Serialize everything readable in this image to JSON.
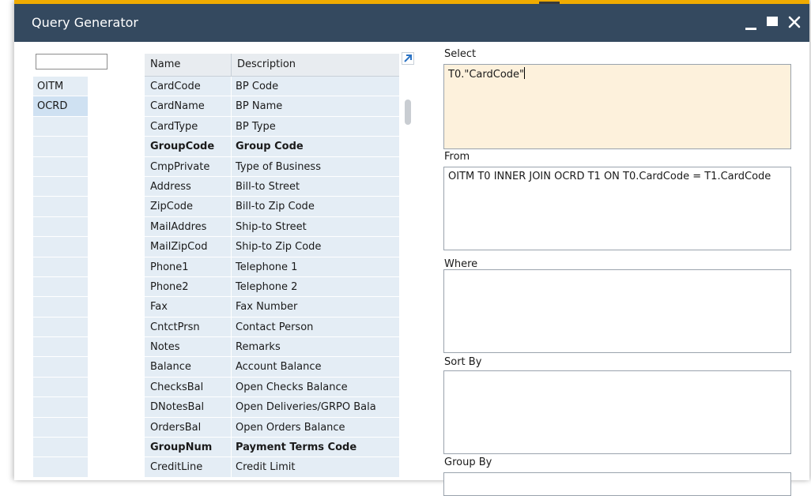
{
  "window": {
    "title": "Query Generator"
  },
  "tables": {
    "search_value": "",
    "items": [
      "OITM",
      "OCRD"
    ],
    "selected": "OCRD",
    "empty_rows": 18
  },
  "fields": {
    "columns": [
      "Name",
      "Description"
    ],
    "rows": [
      {
        "name": "CardCode",
        "desc": "BP Code",
        "bold": false
      },
      {
        "name": "CardName",
        "desc": "BP Name",
        "bold": false
      },
      {
        "name": "CardType",
        "desc": "BP Type",
        "bold": false
      },
      {
        "name": "GroupCode",
        "desc": "Group Code",
        "bold": true
      },
      {
        "name": "CmpPrivate",
        "desc": "Type of Business",
        "bold": false
      },
      {
        "name": "Address",
        "desc": "Bill-to Street",
        "bold": false
      },
      {
        "name": "ZipCode",
        "desc": "Bill-to Zip Code",
        "bold": false
      },
      {
        "name": "MailAddres",
        "desc": "Ship-to Street",
        "bold": false
      },
      {
        "name": "MailZipCod",
        "desc": "Ship-to Zip Code",
        "bold": false
      },
      {
        "name": "Phone1",
        "desc": "Telephone 1",
        "bold": false
      },
      {
        "name": "Phone2",
        "desc": "Telephone 2",
        "bold": false
      },
      {
        "name": "Fax",
        "desc": "Fax Number",
        "bold": false
      },
      {
        "name": "CntctPrsn",
        "desc": "Contact Person",
        "bold": false
      },
      {
        "name": "Notes",
        "desc": "Remarks",
        "bold": false
      },
      {
        "name": "Balance",
        "desc": "Account Balance",
        "bold": false
      },
      {
        "name": "ChecksBal",
        "desc": "Open Checks Balance",
        "bold": false
      },
      {
        "name": "DNotesBal",
        "desc": "Open Deliveries/GRPO Bala",
        "bold": false
      },
      {
        "name": "OrdersBal",
        "desc": "Open Orders Balance",
        "bold": false
      },
      {
        "name": "GroupNum",
        "desc": "Payment Terms Code",
        "bold": true
      },
      {
        "name": "CreditLine",
        "desc": "Credit Limit",
        "bold": false
      }
    ]
  },
  "query": {
    "select_label": "Select",
    "select_value": "T0.\"CardCode\"",
    "from_label": "From",
    "from_value": "OITM T0  INNER JOIN OCRD T1 ON T0.CardCode = T1.CardCode",
    "where_label": "Where",
    "where_value": "",
    "sortby_label": "Sort By",
    "sortby_value": "",
    "groupby_label": "Group By",
    "groupby_value": ""
  },
  "colors": {
    "titlebar": "#34495f",
    "accent": "#f0ab00",
    "row_bg": "#e4edf5",
    "selected_row": "#cfe1f2",
    "select_box_bg": "#fdf1dc"
  }
}
